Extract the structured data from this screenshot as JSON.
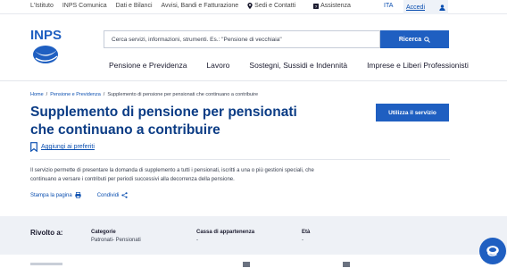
{
  "topbar": {
    "links": [
      "L'Istituto",
      "INPS Comunica",
      "Dati e Bilanci",
      "Avvisi, Bandi e Fatturazione",
      "Sedi e Contatti",
      "Assistenza"
    ],
    "lang": "ITA",
    "access_label": "Accedi"
  },
  "header": {
    "logo_text": "INPS",
    "search_placeholder": "Cerca servizi, informazioni, strumenti. Es.: \"Pensione di vecchiaia\"",
    "search_button": "Ricerca"
  },
  "mainnav": [
    "Pensione e Previdenza",
    "Lavoro",
    "Sostegni, Sussidi e Indennità",
    "Imprese e Liberi Professionisti"
  ],
  "breadcrumb": {
    "home": "Home",
    "sep": "/",
    "section": "Pensione e Previdenza",
    "current": "Supplemento di pensione per pensionati che continuano a contribuire"
  },
  "page": {
    "title": "Supplemento di pensione per pensionati che continuano a contribuire",
    "favorites": "Aggiungi ai preferiti",
    "use_service": "Utilizza il servizio",
    "description": "Il servizio permette di presentare la domanda di supplemento a tutti i pensionati, iscritti a una o più gestioni speciali, che continuano a versare i contributi per periodi successivi alla decorrenza della pensione.",
    "print": "Stampa la pagina",
    "share": "Condividi"
  },
  "audience": {
    "label": "Rivolto a:",
    "columns": [
      {
        "header": "Categorie",
        "value": "Patronati- Pensionati"
      },
      {
        "header": "Cassa di appartenenza",
        "value": "-"
      },
      {
        "header": "Età",
        "value": "-"
      }
    ]
  },
  "colors": {
    "primary": "#1f5fc1",
    "title": "#0b3c85",
    "band": "#eef1f6"
  }
}
